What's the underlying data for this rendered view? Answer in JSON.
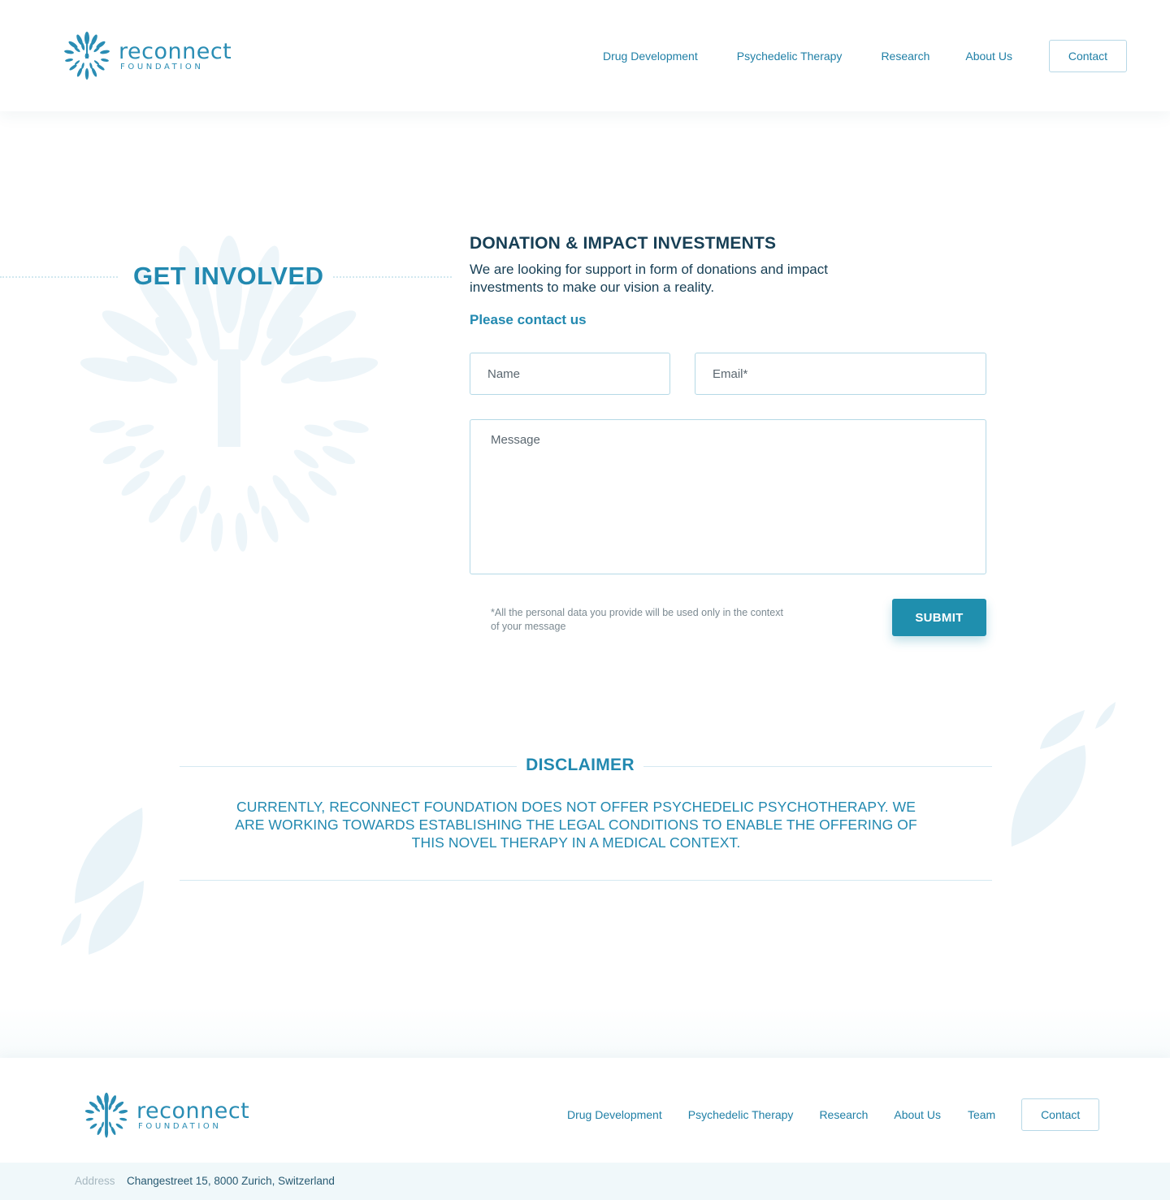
{
  "brand": {
    "name": "reconnect",
    "tagline": "FOUNDATION",
    "color": "#2a8db4"
  },
  "header": {
    "nav": [
      "Drug Development",
      "Psychedelic Therapy",
      "Research",
      "About Us"
    ],
    "contact_label": "Contact"
  },
  "hero": {
    "title": "GET INVOLVED"
  },
  "donation": {
    "title": "DONATION & IMPACT INVESTMENTS",
    "text": "We are looking for support in form of donations and impact investments to make our vision a reality.",
    "contact_prompt": "Please contact us"
  },
  "form": {
    "name_placeholder": "Name",
    "name_value": "",
    "email_placeholder": "Email*",
    "email_value": "",
    "message_placeholder": "Message",
    "message_value": "",
    "privacy_note": "*All the personal data you provide will be used only in the context of your message",
    "submit_label": "SUBMIT",
    "accent_color": "#1f8fae"
  },
  "disclaimer": {
    "title": "DISCLAIMER",
    "text": "CURRENTLY, RECONNECT FOUNDATION DOES NOT OFFER PSYCHEDELIC PSYCHOTHERAPY. WE ARE WORKING TOWARDS ESTABLISHING THE LEGAL CONDITIONS TO ENABLE THE OFFERING OF THIS NOVEL THERAPY IN A MEDICAL CONTEXT."
  },
  "footer": {
    "nav": [
      "Drug Development",
      "Psychedelic Therapy",
      "Research",
      "About Us",
      "Team"
    ],
    "contact_label": "Contact",
    "address_label": "Address",
    "address_value": "Changestreet 15, 8000 Zurich, Switzerland"
  }
}
